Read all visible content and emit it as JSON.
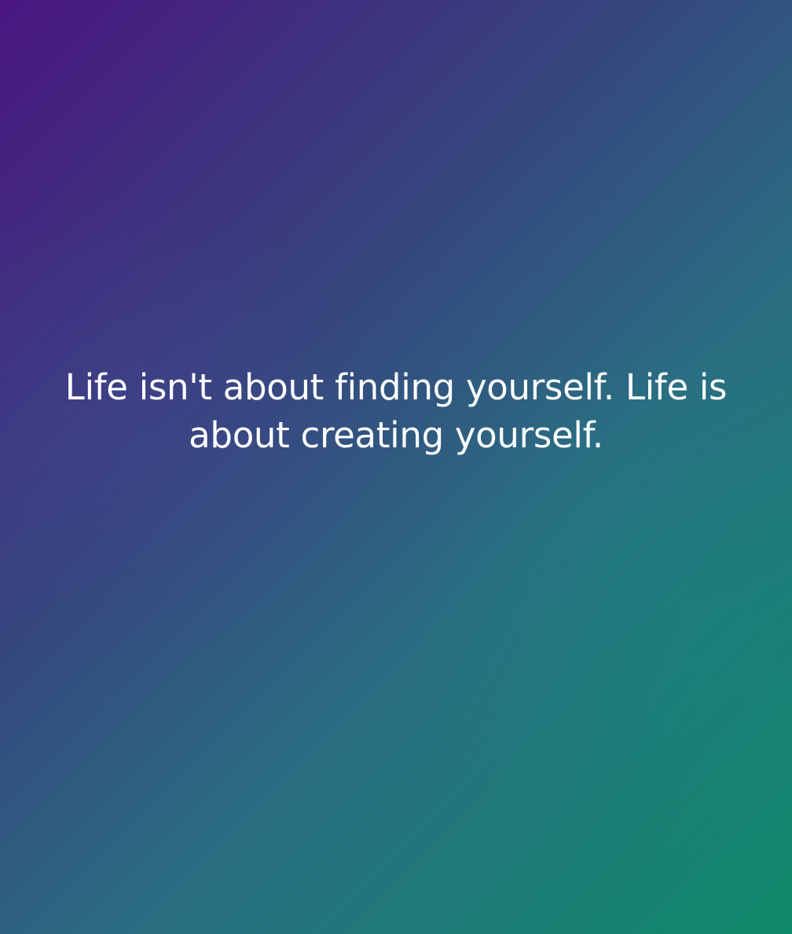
{
  "quote": {
    "text": "Life isn't about finding yourself. Life is about creating yourself."
  },
  "colors": {
    "gradient_top_left": "#4a1680",
    "gradient_mid": "#35477e",
    "gradient_bottom_right": "#0f8a6a",
    "text": "#ffffff"
  }
}
